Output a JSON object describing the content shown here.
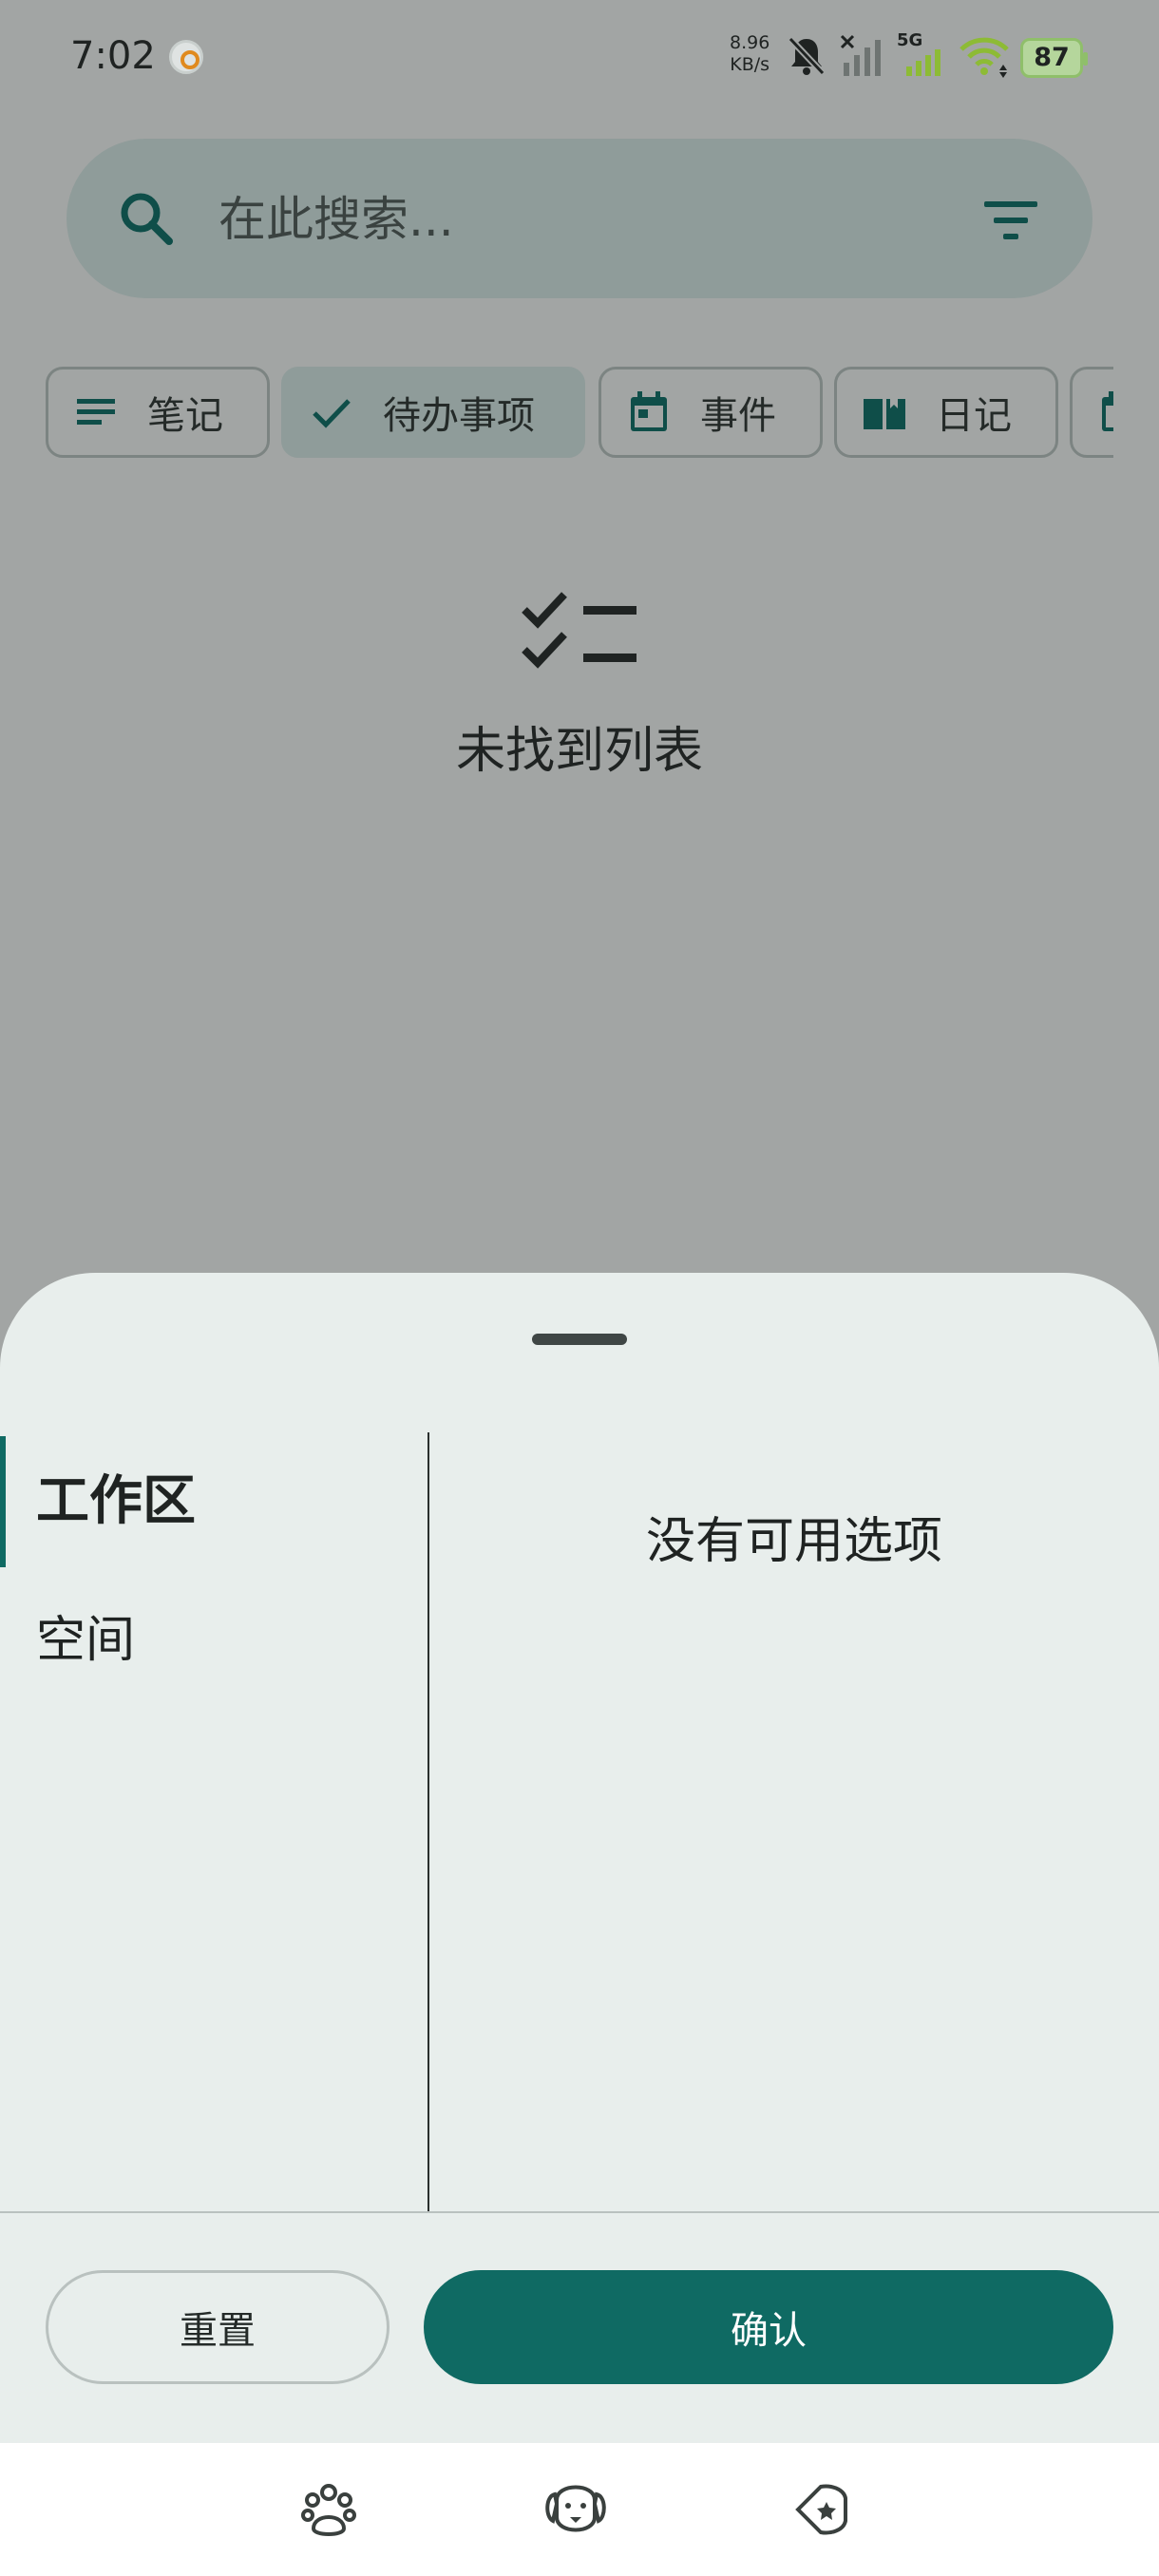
{
  "status_bar": {
    "time": "7:02",
    "net_speed_value": "8.96",
    "net_speed_unit": "KB/s",
    "network_label": "5G",
    "battery_level": "87"
  },
  "search": {
    "placeholder": "在此搜索..."
  },
  "chips": [
    {
      "label": "笔记",
      "icon": "notes-lines-icon",
      "selected": false
    },
    {
      "label": "待办事项",
      "icon": "check-icon",
      "selected": true
    },
    {
      "label": "事件",
      "icon": "calendar-icon",
      "selected": false
    },
    {
      "label": "日记",
      "icon": "book-icon",
      "selected": false
    }
  ],
  "empty_state": {
    "icon": "checklist-icon",
    "message": "未找到列表"
  },
  "sheet": {
    "workspace_items": [
      {
        "label": "工作区",
        "active": true
      },
      {
        "label": "空间",
        "active": false
      }
    ],
    "no_options_text": "没有可用选项",
    "reset_label": "重置",
    "confirm_label": "确认"
  },
  "nav_bar": {
    "buttons": [
      "paw-icon",
      "dog-face-icon",
      "star-tag-icon"
    ]
  },
  "colors": {
    "accent": "#0f6a63",
    "scrim": "#a2a5a4",
    "sheet_bg": "#e8eeec"
  }
}
